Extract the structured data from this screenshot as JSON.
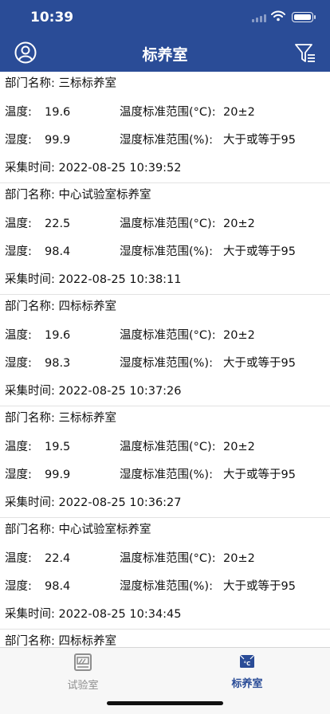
{
  "status_bar": {
    "time": "10:39"
  },
  "nav": {
    "title": "标养室"
  },
  "labels": {
    "dept": "部门名称: ",
    "temp": "温度:",
    "humidity": "湿度:",
    "temp_range": "温度标准范围(°C):",
    "humidity_range": "湿度标准范围(%):",
    "collect_time": "采集时间: "
  },
  "records": [
    {
      "dept": "三标标养室",
      "temp": "19.6",
      "temp_std": "20±2",
      "humidity": "99.9",
      "humidity_std": "大于或等于95",
      "time": "2022-08-25 10:39:52"
    },
    {
      "dept": "中心试验室标养室",
      "temp": "22.5",
      "temp_std": "20±2",
      "humidity": "98.4",
      "humidity_std": "大于或等于95",
      "time": "2022-08-25 10:38:11"
    },
    {
      "dept": "四标标养室",
      "temp": "19.6",
      "temp_std": "20±2",
      "humidity": "98.3",
      "humidity_std": "大于或等于95",
      "time": "2022-08-25 10:37:26"
    },
    {
      "dept": "三标标养室",
      "temp": "19.5",
      "temp_std": "20±2",
      "humidity": "99.9",
      "humidity_std": "大于或等于95",
      "time": "2022-08-25 10:36:27"
    },
    {
      "dept": "中心试验室标养室",
      "temp": "22.4",
      "temp_std": "20±2",
      "humidity": "98.4",
      "humidity_std": "大于或等于95",
      "time": "2022-08-25 10:34:45"
    },
    {
      "dept": "四标标养室"
    }
  ],
  "tabbar": {
    "tabs": [
      {
        "label": "试验室",
        "icon": "lab-icon",
        "active": false
      },
      {
        "label": "标养室",
        "icon": "curing-room-icon",
        "active": true
      }
    ]
  },
  "colors": {
    "primary": "#2a4c97",
    "inactive_tab": "#8e8e8e"
  }
}
